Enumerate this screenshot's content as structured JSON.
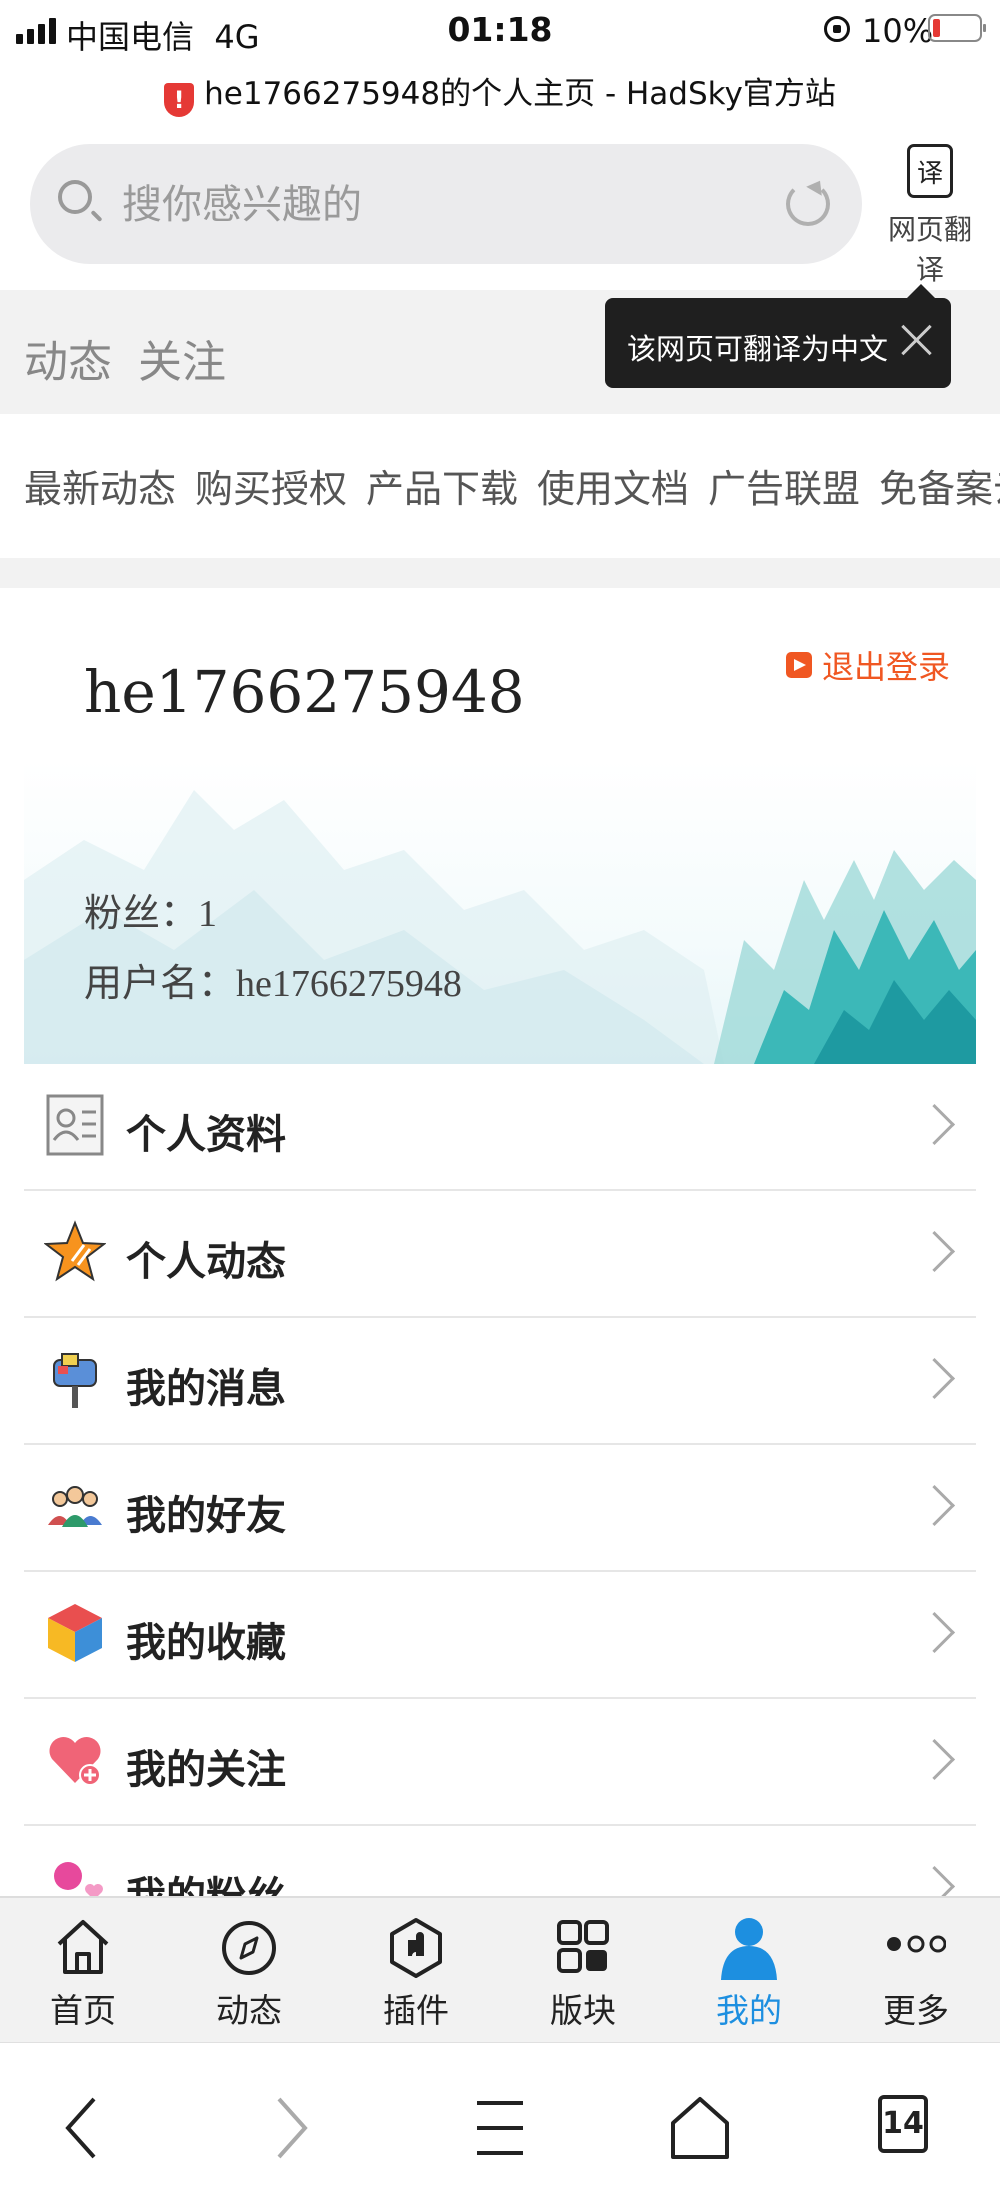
{
  "status_bar": {
    "carrier": "中国电信",
    "network": "4G",
    "time": "01:18",
    "battery": "10%"
  },
  "page_title": "he1766275948的个人主页 - HadSky官方站",
  "search": {
    "placeholder": "搜你感兴趣的"
  },
  "translate": {
    "icon_text": "译",
    "label": "网页翻译",
    "tooltip": "该网页可翻译为中文"
  },
  "tabs": [
    "动态",
    "关注"
  ],
  "nav_links": [
    "最新动态",
    "购买授权",
    "产品下载",
    "使用文档",
    "广告联盟",
    "免备案云"
  ],
  "profile": {
    "username": "he1766275948",
    "logout": "退出登录",
    "fans_label": "粉丝：",
    "fans_count": "1",
    "username_label": "用户名：",
    "username_value": "he1766275948"
  },
  "menu": [
    {
      "label": "个人资料",
      "icon": "profile-card-icon"
    },
    {
      "label": "个人动态",
      "icon": "star-icon"
    },
    {
      "label": "我的消息",
      "icon": "mailbox-icon"
    },
    {
      "label": "我的好友",
      "icon": "friends-icon"
    },
    {
      "label": "我的收藏",
      "icon": "cube-icon"
    },
    {
      "label": "我的关注",
      "icon": "heart-plus-icon"
    },
    {
      "label": "我的粉丝",
      "icon": "fans-icon"
    }
  ],
  "app_nav": [
    {
      "label": "首页",
      "icon": "home-icon"
    },
    {
      "label": "动态",
      "icon": "compass-icon"
    },
    {
      "label": "插件",
      "icon": "plugin-icon"
    },
    {
      "label": "版块",
      "icon": "grid-icon"
    },
    {
      "label": "我的",
      "icon": "user-icon",
      "active": true
    },
    {
      "label": "更多",
      "icon": "more-icon"
    }
  ],
  "browser": {
    "tab_count": "14"
  },
  "colors": {
    "accent": "#1d8fe0",
    "logout": "#f05722",
    "banner_teal": "#2bb3b8"
  }
}
